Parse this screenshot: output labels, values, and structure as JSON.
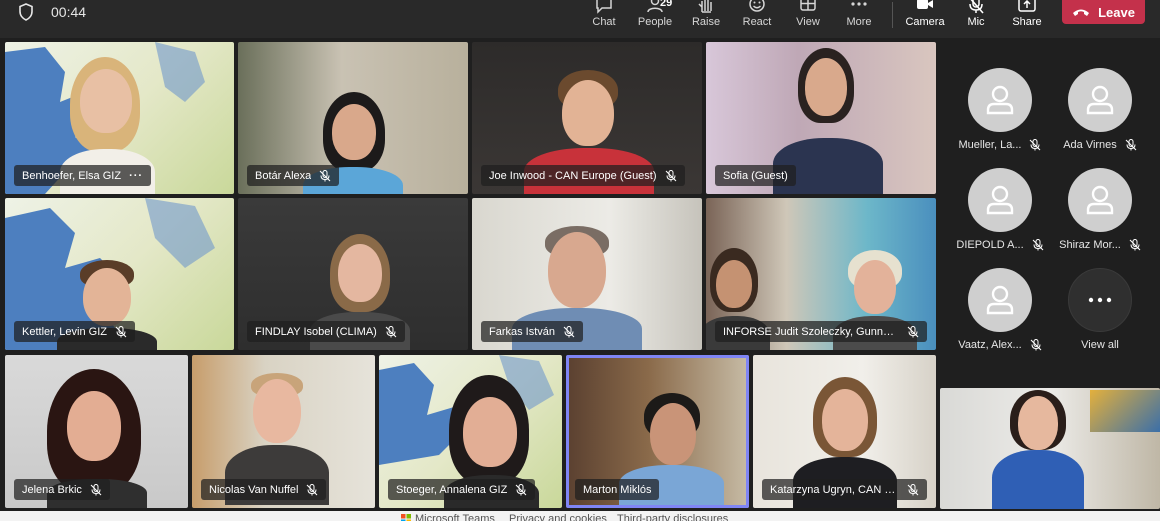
{
  "timer": "00:44",
  "toolbar": {
    "chat": "Chat",
    "people": "People",
    "people_count": "29",
    "raise": "Raise",
    "react": "React",
    "view": "View",
    "more": "More",
    "camera": "Camera",
    "mic": "Mic",
    "share": "Share",
    "leave": "Leave"
  },
  "colors": {
    "leave_red": "#c4314b",
    "speaking_outline": "#7f85f5",
    "top_bar": "#292929",
    "stage_bg": "#1f1f1f"
  },
  "tiles": [
    {
      "name": "Benhoefer, Elsa GIZ",
      "more_dots": "···"
    },
    {
      "name": "Botár Alexa"
    },
    {
      "name": "Joe Inwood - CAN Europe (Guest)"
    },
    {
      "name": "Sofia (Guest)"
    },
    {
      "name": "Kettler, Levin GIZ"
    },
    {
      "name": "FINDLAY Isobel (CLIMA)"
    },
    {
      "name": "Farkas István"
    },
    {
      "name": "INFORSE Judit Szoleczky, Gunnar ..."
    },
    {
      "name": "Jelena Brkic"
    },
    {
      "name": "Nicolas Van Nuffel"
    },
    {
      "name": "Stoeger, Annalena GIZ"
    },
    {
      "name": "Marton Miklós"
    },
    {
      "name": "Katarzyna Ugryn, CAN Eu..."
    }
  ],
  "roster": [
    {
      "name": "Mueller, La..."
    },
    {
      "name": "Ada Virnes"
    },
    {
      "name": "DIEPOLD A..."
    },
    {
      "name": "Shiraz Mor..."
    },
    {
      "name": "Vaatz, Alex..."
    }
  ],
  "view_all": "View all",
  "footer": {
    "app": "Microsoft Teams",
    "privacy": "Privacy and cookies",
    "third_party": "Third-party disclosures"
  }
}
